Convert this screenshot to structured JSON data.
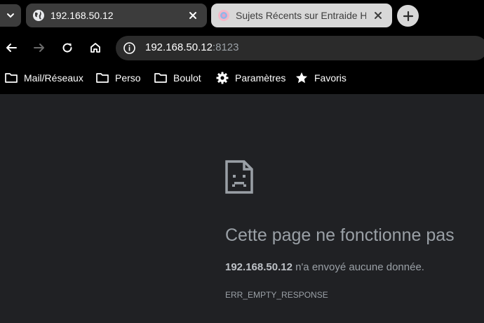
{
  "tabs": [
    {
      "title": "192.168.50.12",
      "active": true,
      "favicon": "globe-icon"
    },
    {
      "title": "Sujets Récents sur Entraide Home Assistant",
      "active": false,
      "favicon": "home-assistant-icon"
    }
  ],
  "toolbar": {
    "url_host": "192.168.50.12",
    "url_port": ":8123"
  },
  "bookmarks": [
    {
      "label": "Mail/Réseaux",
      "icon": "folder-icon"
    },
    {
      "label": "Perso",
      "icon": "folder-icon"
    },
    {
      "label": "Boulot",
      "icon": "folder-icon"
    },
    {
      "label": "Paramètres",
      "icon": "gear-icon"
    },
    {
      "label": "Favoris",
      "icon": "star-icon"
    }
  ],
  "error": {
    "title": "Cette page ne fonctionne pas",
    "host": "192.168.50.12",
    "message": " n'a envoyé aucune donnée.",
    "code": "ERR_EMPTY_RESPONSE"
  },
  "colors": {
    "chrome_bg": "#000000",
    "page_bg": "#202124",
    "text_muted": "#9aa0a6"
  }
}
